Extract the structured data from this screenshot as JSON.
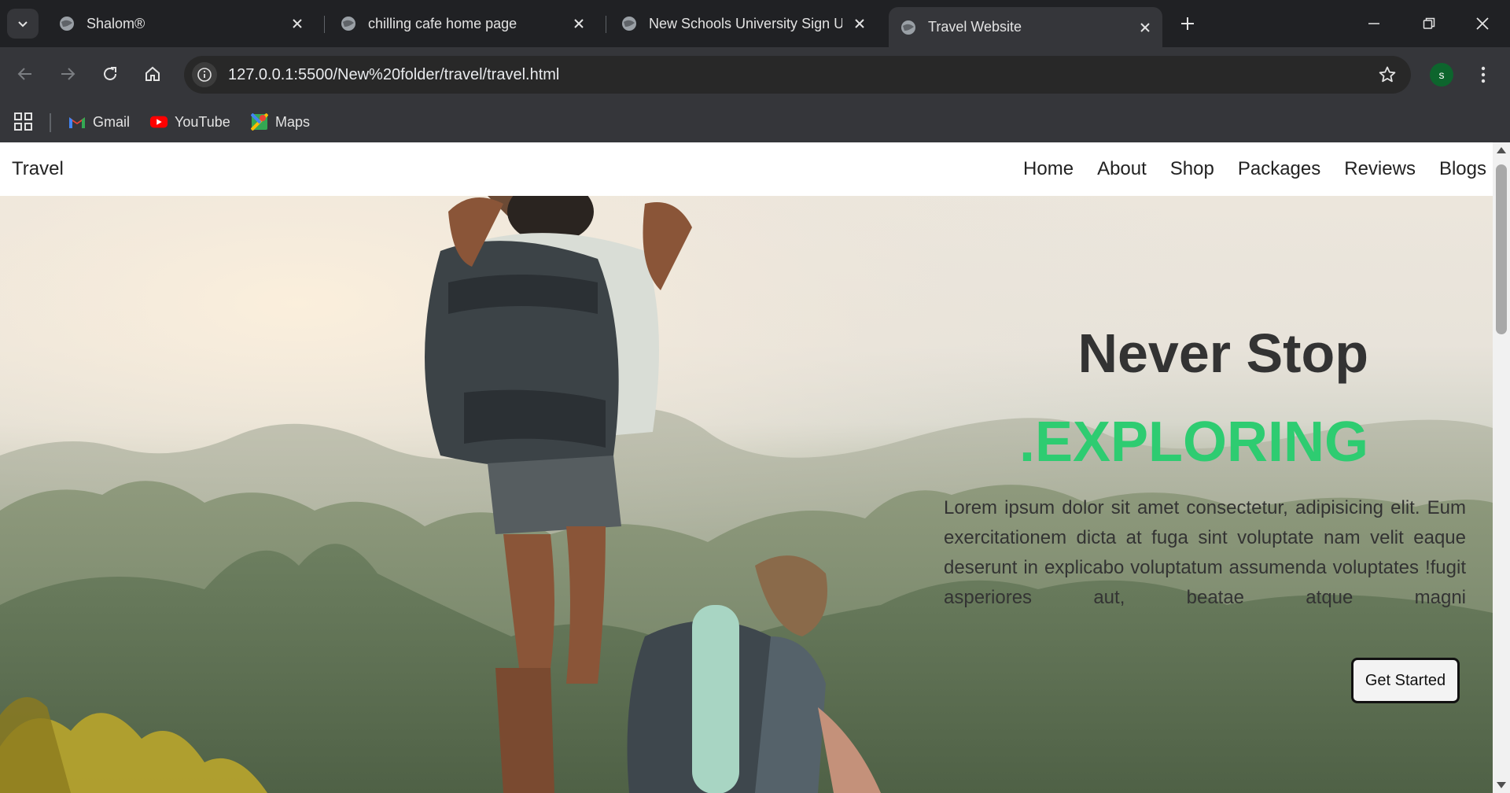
{
  "browser": {
    "tabs": [
      {
        "title": "Shalom®"
      },
      {
        "title": "chilling cafe home page"
      },
      {
        "title": "New Schools University Sign Up"
      },
      {
        "title": "Travel Website"
      }
    ],
    "url_host": "127.0.0.1",
    "url_rest": ":5500/New%20folder/travel/travel.html",
    "profile_initial": "s",
    "bookmarks": [
      {
        "label": "Gmail"
      },
      {
        "label": "YouTube"
      },
      {
        "label": "Maps"
      }
    ]
  },
  "site": {
    "logo": "Travel",
    "nav": [
      "Home",
      "About",
      "Shop",
      "Packages",
      "Reviews",
      "Blogs"
    ],
    "hero": {
      "title": "Never Stop",
      "subtitle": ".EXPLORING",
      "paragraph": "Lorem ipsum dolor sit amet consectetur, adipisicing elit. Eum exercitationem dicta at fuga sint voluptate nam velit eaque deserunt in explicabo voluptatum assumenda voluptates !fugit asperiores aut, beatae atque magni",
      "button": "Get Started"
    }
  },
  "colors": {
    "accent": "#2ecc71",
    "chrome_dark": "#202124",
    "chrome_toolbar": "#35363a"
  }
}
